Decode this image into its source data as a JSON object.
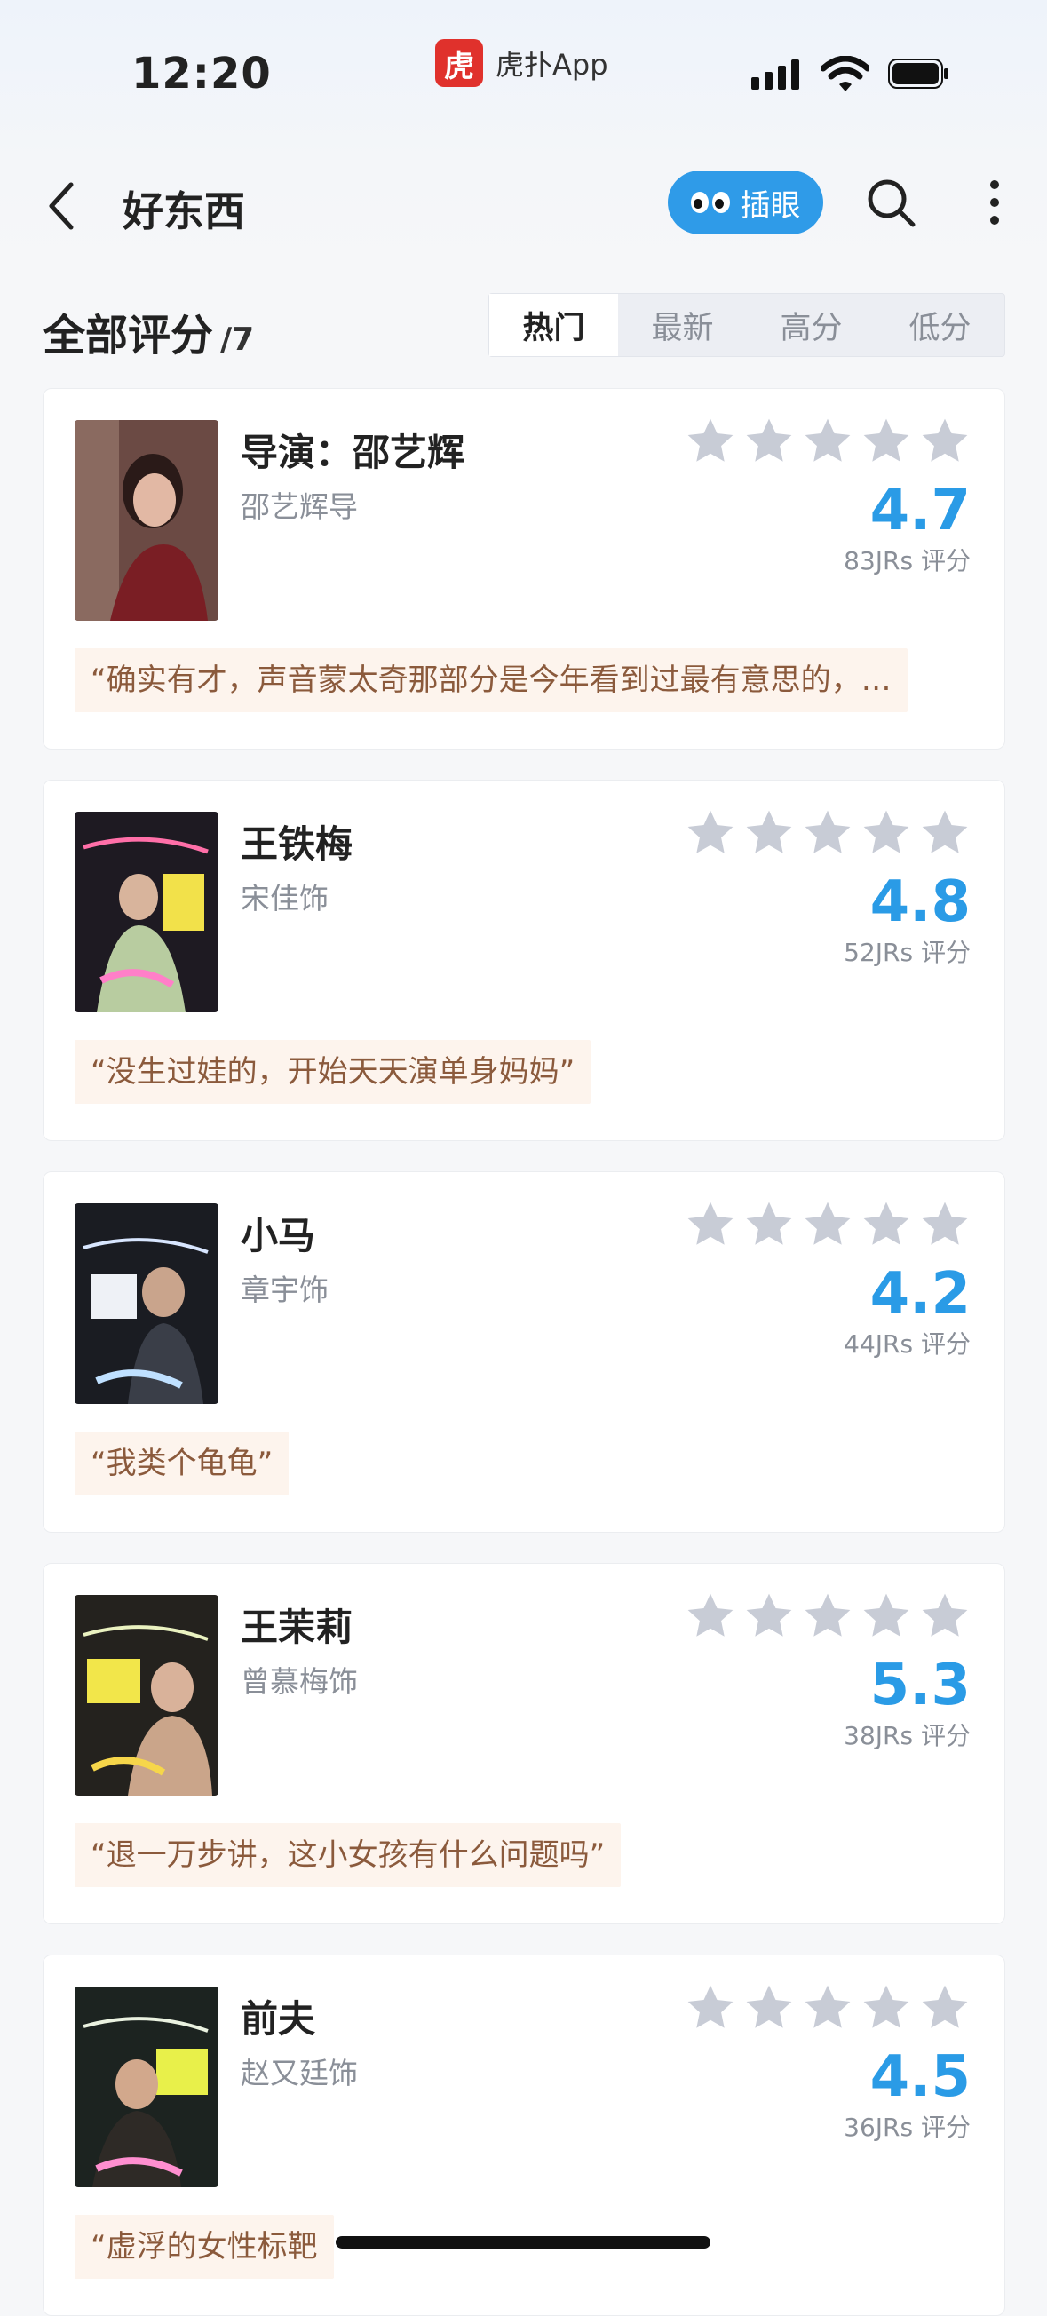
{
  "status_bar": {
    "time": "12:20",
    "app_name": "虎扑App",
    "app_logo_char": "虎"
  },
  "nav": {
    "title": "好东西",
    "peek_label": "插眼"
  },
  "section": {
    "title": "全部评分",
    "count": "/7"
  },
  "tabs": [
    "热门",
    "最新",
    "高分",
    "低分"
  ],
  "colors": {
    "accent": "#2a9be6",
    "quote_bg": "#fdf4ed",
    "quote_text": "#8b5a3c",
    "star": "#c8ccd6"
  },
  "cards": [
    {
      "name": "导演：邵艺辉",
      "role": "邵艺辉导",
      "score": "4.7",
      "votes": "83JRs 评分",
      "quote": "“确实有才，声音蒙太奇那部分是今年看到过最有意思的，…"
    },
    {
      "name": "王铁梅",
      "role": "宋佳饰",
      "score": "4.8",
      "votes": "52JRs 评分",
      "quote": "“没生过娃的，开始天天演单身妈妈”"
    },
    {
      "name": "小马",
      "role": "章宇饰",
      "score": "4.2",
      "votes": "44JRs 评分",
      "quote": "“我类个龟龟”"
    },
    {
      "name": "王茉莉",
      "role": "曾慕梅饰",
      "score": "5.3",
      "votes": "38JRs 评分",
      "quote": "“退一万步讲，这小女孩有什么问题吗”"
    },
    {
      "name": "前夫",
      "role": "赵又廷饰",
      "score": "4.5",
      "votes": "36JRs 评分",
      "quote": "“虚浮的女性标靶"
    }
  ]
}
